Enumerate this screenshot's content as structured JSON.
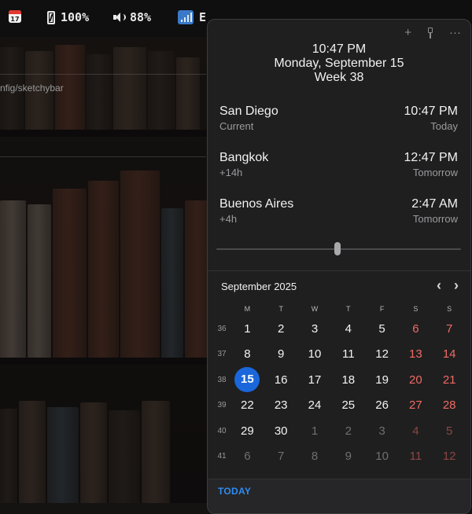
{
  "menubar": {
    "calendar_icon_day": "17",
    "battery_label": "100%",
    "volume_label": "88%",
    "network_label": "E"
  },
  "background": {
    "terminal_path": "nfig/sketchybar"
  },
  "popover": {
    "actions": {
      "add": "+",
      "more": "···"
    },
    "header": {
      "time": "10:47 PM",
      "date": "Monday, September 15",
      "week": "Week 38"
    },
    "zones": [
      {
        "city": "San Diego",
        "offset": "Current",
        "time": "10:47 PM",
        "day": "Today"
      },
      {
        "city": "Bangkok",
        "offset": "+14h",
        "time": "12:47 PM",
        "day": "Tomorrow"
      },
      {
        "city": "Buenos Aires",
        "offset": "+4h",
        "time": "2:47 AM",
        "day": "Tomorrow"
      }
    ],
    "time_slider": {
      "value": 0.5
    },
    "calendar": {
      "month_title": "September 2025",
      "prev": "‹",
      "next": "›",
      "weekdays": [
        "M",
        "T",
        "W",
        "T",
        "F",
        "S",
        "S"
      ],
      "weeks": [
        {
          "week": "36",
          "days": [
            "1",
            "2",
            "3",
            "4",
            "5",
            "6",
            "7"
          ]
        },
        {
          "week": "37",
          "days": [
            "8",
            "9",
            "10",
            "11",
            "12",
            "13",
            "14"
          ]
        },
        {
          "week": "38",
          "days": [
            "15",
            "16",
            "17",
            "18",
            "19",
            "20",
            "21"
          ]
        },
        {
          "week": "39",
          "days": [
            "22",
            "23",
            "24",
            "25",
            "26",
            "27",
            "28"
          ]
        },
        {
          "week": "40",
          "days": [
            "29",
            "30",
            "1",
            "2",
            "3",
            "4",
            "5"
          ]
        },
        {
          "week": "41",
          "days": [
            "6",
            "7",
            "8",
            "9",
            "10",
            "11",
            "12"
          ]
        }
      ],
      "selected_day": "15"
    },
    "footer": {
      "today_label": "TODAY"
    }
  },
  "colors": {
    "accent": "#1a67db",
    "weekend": "#ef6a63",
    "today_link": "#2e8cf2"
  }
}
